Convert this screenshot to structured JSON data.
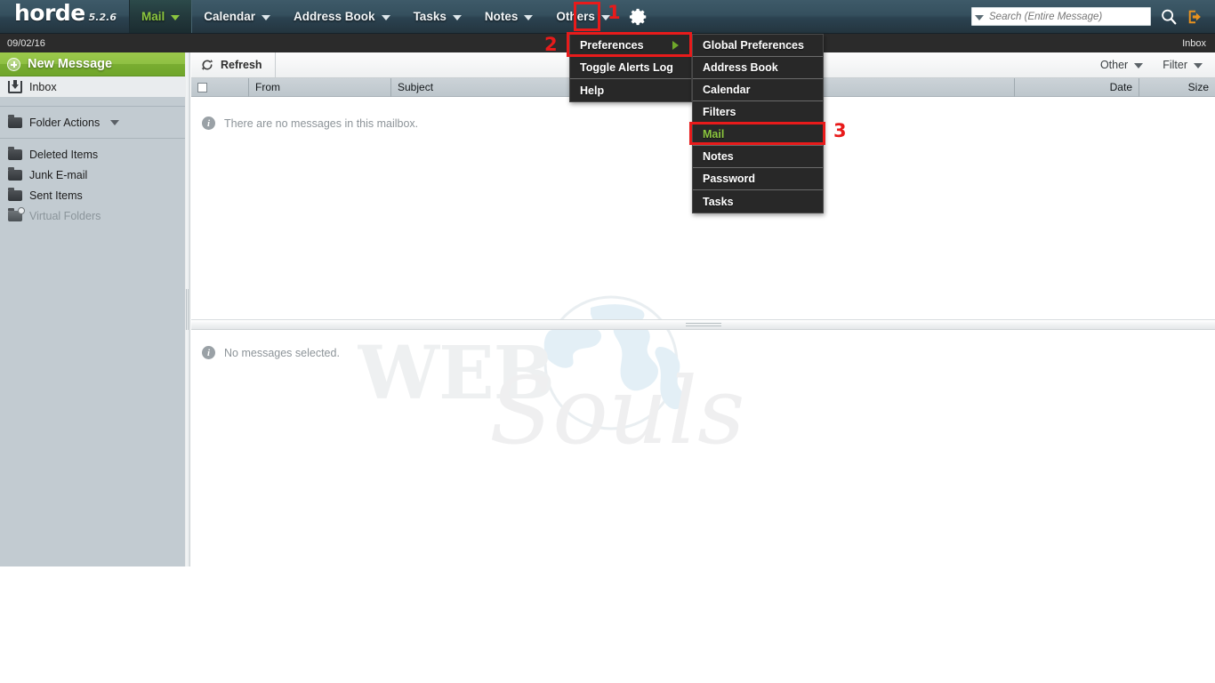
{
  "topbar": {
    "logo": "horde",
    "version": "5.2.6",
    "nav": [
      {
        "label": "Mail",
        "active": true
      },
      {
        "label": "Calendar",
        "active": false
      },
      {
        "label": "Address Book",
        "active": false
      },
      {
        "label": "Tasks",
        "active": false
      },
      {
        "label": "Notes",
        "active": false
      },
      {
        "label": "Others",
        "active": false
      }
    ],
    "gear_icon": "gear-icon",
    "search": {
      "placeholder": "Search (Entire Message)",
      "value": "",
      "dropdown_icon": "chevron-down-icon",
      "search_icon": "search-icon"
    },
    "logout_icon": "logout-icon"
  },
  "subbar": {
    "date": "09/02/16",
    "location": "Inbox"
  },
  "sidebar": {
    "new_message": "New Message",
    "new_message_icon": "plus-circle-icon",
    "inbox": {
      "label": "Inbox",
      "icon": "inbox-icon"
    },
    "folder_actions": {
      "label": "Folder Actions",
      "icon": "folder-icon",
      "caret": "chevron-down-icon"
    },
    "folders": [
      {
        "label": "Deleted Items",
        "icon": "folder-icon",
        "muted": false
      },
      {
        "label": "Junk E-mail",
        "icon": "folder-icon",
        "muted": false
      },
      {
        "label": "Sent Items",
        "icon": "folder-icon",
        "muted": false
      },
      {
        "label": "Virtual Folders",
        "icon": "virtual-folder-icon",
        "muted": true
      }
    ]
  },
  "toolbar": {
    "refresh": "Refresh",
    "refresh_icon": "refresh-icon",
    "other": "Other",
    "filter": "Filter"
  },
  "columns": {
    "checkbox": "",
    "from": "From",
    "subject": "Subject",
    "date": "Date",
    "size": "Size"
  },
  "message_list": {
    "empty_text": "There are no messages in this mailbox.",
    "info_icon": "info-icon"
  },
  "preview": {
    "empty_text": "No messages selected.",
    "info_icon": "info-icon"
  },
  "watermark": {
    "text_top": "WEB",
    "text_bottom": "Souls"
  },
  "menus": {
    "settings": [
      {
        "label": "Preferences",
        "has_submenu": true,
        "highlighted": false
      },
      {
        "label": "Toggle Alerts Log",
        "has_submenu": false,
        "highlighted": false
      },
      {
        "label": "Help",
        "has_submenu": false,
        "highlighted": false
      }
    ],
    "preferences": [
      {
        "label": "Global Preferences",
        "highlighted": false
      },
      {
        "label": "Address Book",
        "highlighted": false
      },
      {
        "label": "Calendar",
        "highlighted": false
      },
      {
        "label": "Filters",
        "highlighted": false
      },
      {
        "label": "Mail",
        "highlighted": true
      },
      {
        "label": "Notes",
        "highlighted": false
      },
      {
        "label": "Password",
        "highlighted": false
      },
      {
        "label": "Tasks",
        "highlighted": false
      }
    ]
  },
  "annotations": [
    {
      "number": "1"
    },
    {
      "number": "2"
    },
    {
      "number": "3"
    }
  ],
  "colors": {
    "accent_green": "#8cc63f",
    "annotation_red": "#e81b1b",
    "topbar_dark": "#2b4250",
    "sidebar_bg": "#c2cbd1"
  }
}
